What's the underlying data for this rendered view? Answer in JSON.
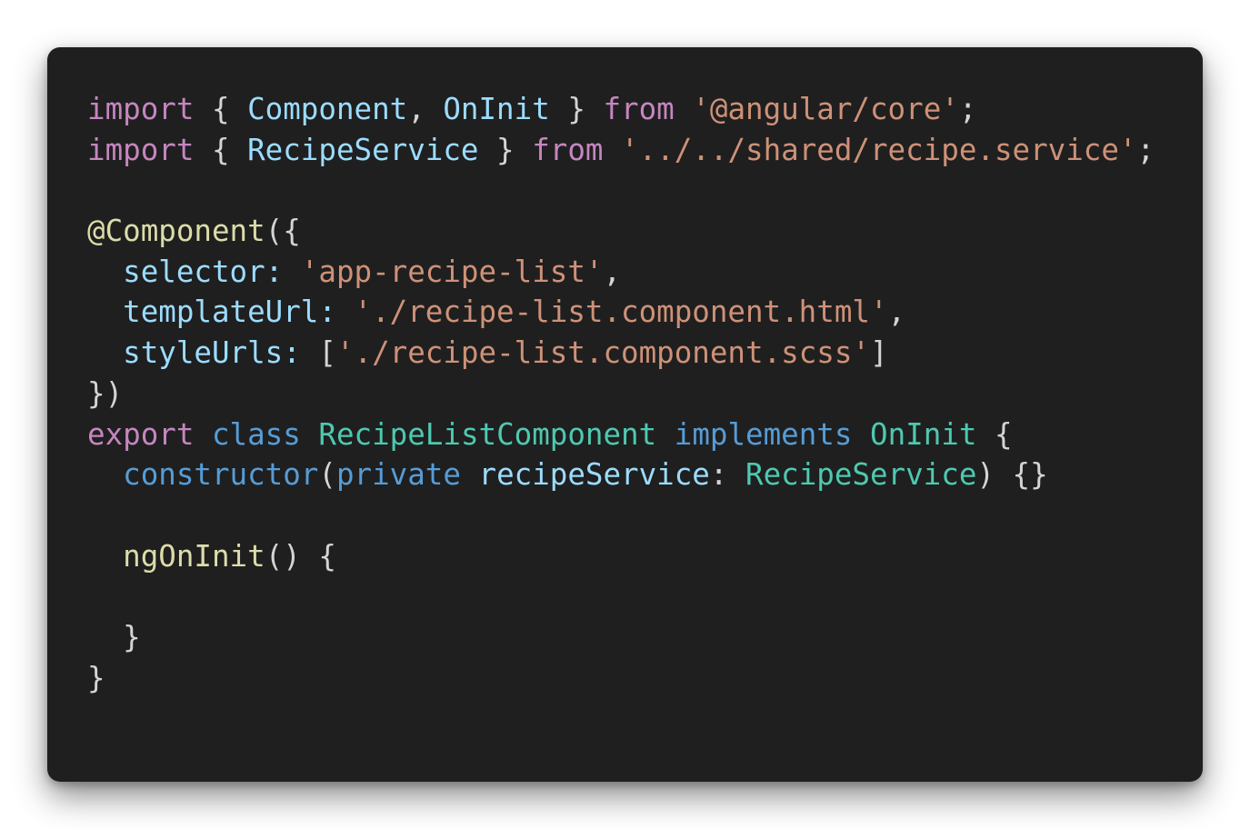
{
  "code": {
    "lines": [
      [
        {
          "t": "import",
          "c": "kw-ctrl"
        },
        {
          "t": " { ",
          "c": "punct"
        },
        {
          "t": "Component",
          "c": "var"
        },
        {
          "t": ", ",
          "c": "punct"
        },
        {
          "t": "OnInit",
          "c": "var"
        },
        {
          "t": " } ",
          "c": "punct"
        },
        {
          "t": "from",
          "c": "kw-ctrl"
        },
        {
          "t": " ",
          "c": "punct"
        },
        {
          "t": "'@angular/core'",
          "c": "str"
        },
        {
          "t": ";",
          "c": "punct"
        }
      ],
      [
        {
          "t": "import",
          "c": "kw-ctrl"
        },
        {
          "t": " { ",
          "c": "punct"
        },
        {
          "t": "RecipeService",
          "c": "var"
        },
        {
          "t": " } ",
          "c": "punct"
        },
        {
          "t": "from",
          "c": "kw-ctrl"
        },
        {
          "t": " ",
          "c": "punct"
        },
        {
          "t": "'../../shared/recipe.service'",
          "c": "str"
        },
        {
          "t": ";",
          "c": "punct"
        }
      ],
      [],
      [
        {
          "t": "@Component",
          "c": "fn"
        },
        {
          "t": "({",
          "c": "punct"
        }
      ],
      [
        {
          "t": "  ",
          "c": "punct"
        },
        {
          "t": "selector",
          "c": "var"
        },
        {
          "t": ": ",
          "c": "var"
        },
        {
          "t": "'app-recipe-list'",
          "c": "str"
        },
        {
          "t": ",",
          "c": "punct"
        }
      ],
      [
        {
          "t": "  ",
          "c": "punct"
        },
        {
          "t": "templateUrl",
          "c": "var"
        },
        {
          "t": ": ",
          "c": "var"
        },
        {
          "t": "'./recipe-list.component.html'",
          "c": "str"
        },
        {
          "t": ",",
          "c": "punct"
        }
      ],
      [
        {
          "t": "  ",
          "c": "punct"
        },
        {
          "t": "styleUrls",
          "c": "var"
        },
        {
          "t": ": ",
          "c": "var"
        },
        {
          "t": "[",
          "c": "punct"
        },
        {
          "t": "'./recipe-list.component.scss'",
          "c": "str"
        },
        {
          "t": "]",
          "c": "punct"
        }
      ],
      [
        {
          "t": "})",
          "c": "punct"
        }
      ],
      [
        {
          "t": "export",
          "c": "kw-ctrl"
        },
        {
          "t": " ",
          "c": "punct"
        },
        {
          "t": "class",
          "c": "kw"
        },
        {
          "t": " ",
          "c": "punct"
        },
        {
          "t": "RecipeListComponent",
          "c": "type"
        },
        {
          "t": " ",
          "c": "punct"
        },
        {
          "t": "implements",
          "c": "kw"
        },
        {
          "t": " ",
          "c": "punct"
        },
        {
          "t": "OnInit",
          "c": "type"
        },
        {
          "t": " {",
          "c": "punct"
        }
      ],
      [
        {
          "t": "  ",
          "c": "punct"
        },
        {
          "t": "constructor",
          "c": "kw"
        },
        {
          "t": "(",
          "c": "punct"
        },
        {
          "t": "private",
          "c": "kw"
        },
        {
          "t": " ",
          "c": "punct"
        },
        {
          "t": "recipeService",
          "c": "var"
        },
        {
          "t": ": ",
          "c": "punct"
        },
        {
          "t": "RecipeService",
          "c": "type"
        },
        {
          "t": ") {}",
          "c": "punct"
        }
      ],
      [],
      [
        {
          "t": "  ",
          "c": "punct"
        },
        {
          "t": "ngOnInit",
          "c": "fn"
        },
        {
          "t": "() {",
          "c": "punct"
        }
      ],
      [],
      [
        {
          "t": "  }",
          "c": "punct"
        }
      ],
      [
        {
          "t": "}",
          "c": "punct"
        }
      ]
    ]
  }
}
